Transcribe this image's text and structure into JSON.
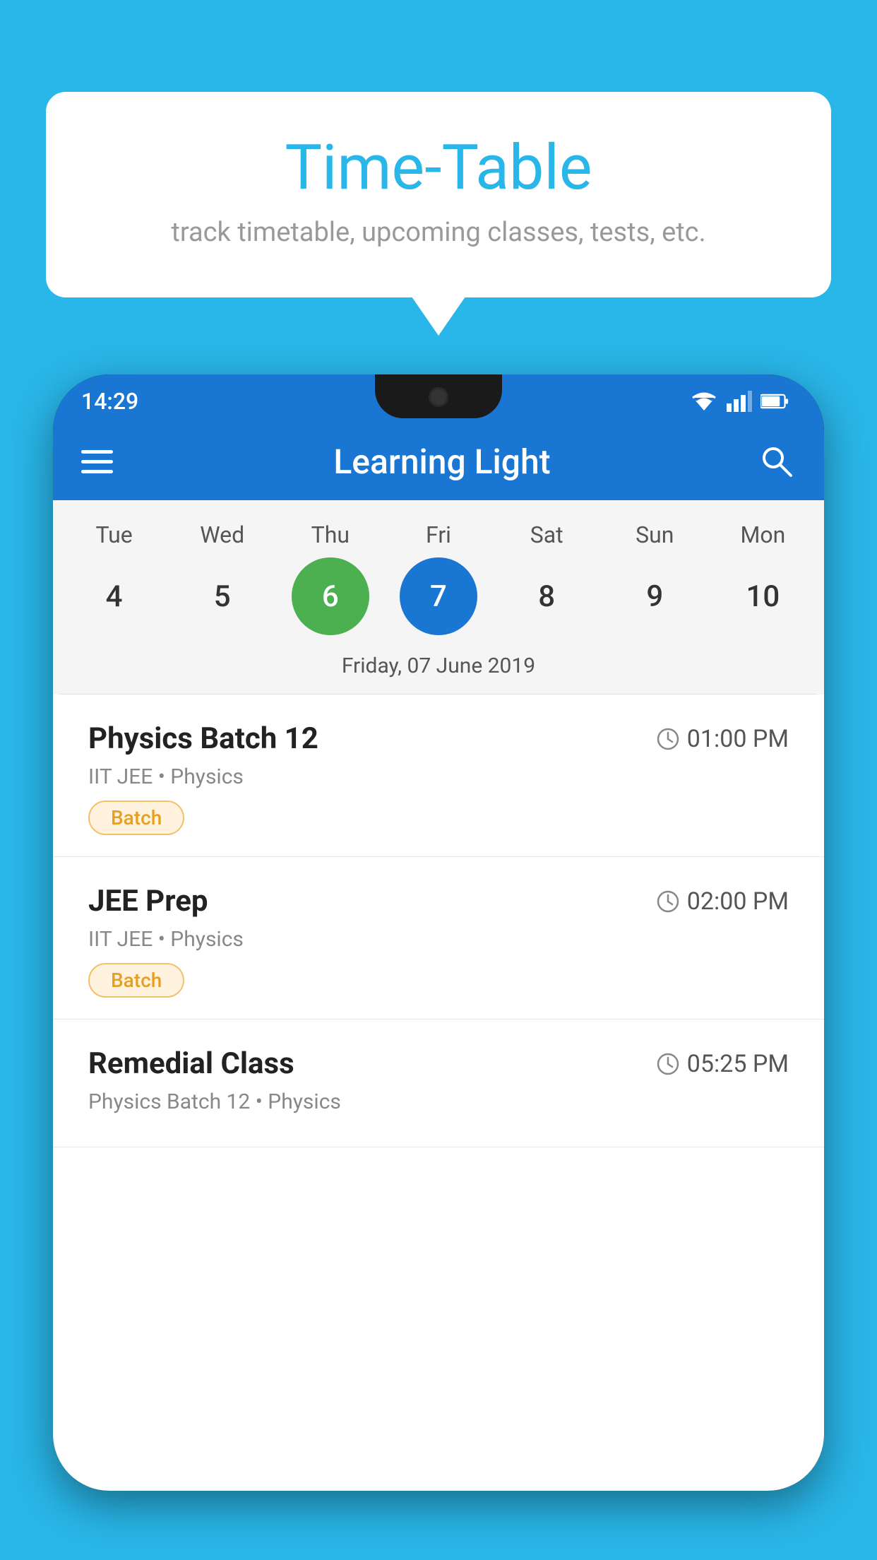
{
  "background_color": "#29b6e8",
  "speech_bubble": {
    "title": "Time-Table",
    "subtitle": "track timetable, upcoming classes, tests, etc."
  },
  "app": {
    "status_time": "14:29",
    "title": "Learning Light"
  },
  "calendar": {
    "days": [
      {
        "label": "Tue",
        "number": 4,
        "state": "normal"
      },
      {
        "label": "Wed",
        "number": 5,
        "state": "normal"
      },
      {
        "label": "Thu",
        "number": 6,
        "state": "today"
      },
      {
        "label": "Fri",
        "number": 7,
        "state": "selected"
      },
      {
        "label": "Sat",
        "number": 8,
        "state": "normal"
      },
      {
        "label": "Sun",
        "number": 9,
        "state": "normal"
      },
      {
        "label": "Mon",
        "number": 10,
        "state": "normal"
      }
    ],
    "selected_date_label": "Friday, 07 June 2019"
  },
  "schedule": [
    {
      "title": "Physics Batch 12",
      "time": "01:00 PM",
      "subtitle": "IIT JEE • Physics",
      "badge": "Batch"
    },
    {
      "title": "JEE Prep",
      "time": "02:00 PM",
      "subtitle": "IIT JEE • Physics",
      "badge": "Batch"
    },
    {
      "title": "Remedial Class",
      "time": "05:25 PM",
      "subtitle": "Physics Batch 12 • Physics",
      "badge": null
    }
  ],
  "icons": {
    "search": "🔍",
    "clock": "⏱"
  }
}
